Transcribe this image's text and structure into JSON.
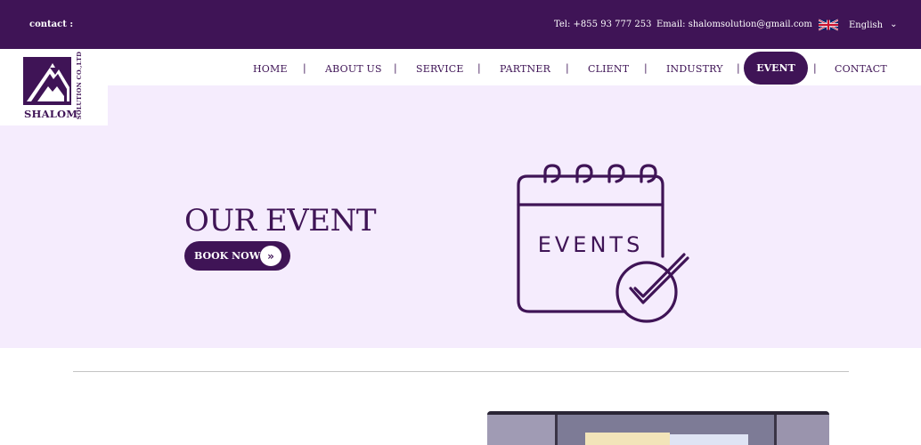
{
  "topbar": {
    "contact_label": "contact :",
    "tel": "Tel: +855 93 777 253",
    "email": "Email: shalomsolution@gmail.com",
    "language": "English",
    "flag_icon": "uk-flag-icon",
    "chevron_icon": "chevron-down-icon"
  },
  "logo": {
    "name": "SHALOM",
    "subtitle": "SOLUTION CO.,LTD"
  },
  "nav": {
    "items": [
      {
        "label": "HOME"
      },
      {
        "label": "ABOUT US"
      },
      {
        "label": "SERVICE"
      },
      {
        "label": "PARTNER"
      },
      {
        "label": "CLIENT"
      },
      {
        "label": "INDUSTRY"
      },
      {
        "label": "EVENT",
        "active": true
      },
      {
        "label": "CONTACT"
      }
    ],
    "separator": "|"
  },
  "hero": {
    "title": "OUR EVENT",
    "button_label": "BOOK NOW",
    "button_icon": "double-chevron-right-icon",
    "illustration_text": "EVENTS",
    "illustration_icon": "calendar-check-icon"
  },
  "colors": {
    "brand": "#3f1456",
    "hero_background": "#f5ecfd",
    "white": "#ffffff",
    "divider": "#c4c4c4"
  }
}
